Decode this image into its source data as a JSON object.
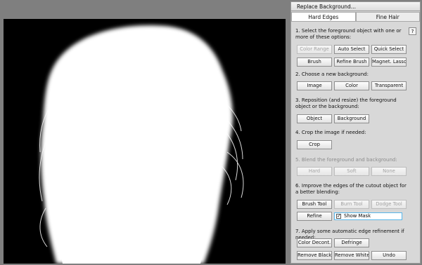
{
  "panel": {
    "title": "Replace Background...",
    "tabs": [
      "Hard Edges",
      "Fine Hair"
    ],
    "help_label": "?",
    "steps": [
      {
        "text": "1. Select the foreground object with one or more of these options:",
        "buttons": [
          "Color Range",
          "Auto Select",
          "Quick Select",
          "Brush",
          "Refine Brush",
          "Magnet. Lasso"
        ]
      },
      {
        "text": "2. Choose a new background:",
        "buttons": [
          "Image",
          "Color",
          "Transparent"
        ]
      },
      {
        "text": "3. Reposition (and resize) the foreground object or the background:",
        "buttons": [
          "Object",
          "Background"
        ]
      },
      {
        "text": "4. Crop the image if needed:",
        "buttons": [
          "Crop"
        ]
      },
      {
        "text": "5. Blend the foreground and background:",
        "buttons": [
          "Hard",
          "Soft",
          "None"
        ]
      },
      {
        "text": "6. Improve the edges of the cutout object for a better blending:",
        "buttons": [
          "Brush Tool",
          "Burn Tool",
          "Dodge Tool",
          "Refine"
        ]
      },
      {
        "text": "7. Apply some automatic edge refinement if needed:",
        "buttons": [
          "Color Decont.",
          "Defringe",
          "Remove Black",
          "Remove White",
          "Undo"
        ]
      }
    ],
    "show_mask": {
      "label": "Show Mask",
      "checked": true,
      "mark": "✓"
    }
  },
  "colors": {
    "canvas_bg": "#000000",
    "mask": "#ffffff",
    "panel_bg": "#d8d8d8",
    "focus": "#58b6ea"
  }
}
